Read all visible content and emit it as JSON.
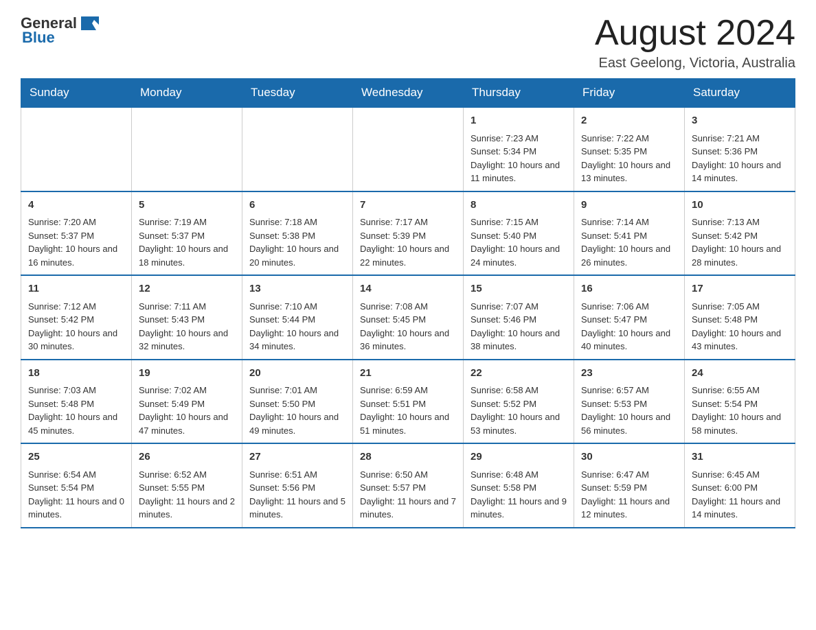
{
  "logo": {
    "general": "General",
    "blue": "Blue"
  },
  "title": "August 2024",
  "location": "East Geelong, Victoria, Australia",
  "days_of_week": [
    "Sunday",
    "Monday",
    "Tuesday",
    "Wednesday",
    "Thursday",
    "Friday",
    "Saturday"
  ],
  "weeks": [
    [
      {
        "day": "",
        "info": ""
      },
      {
        "day": "",
        "info": ""
      },
      {
        "day": "",
        "info": ""
      },
      {
        "day": "",
        "info": ""
      },
      {
        "day": "1",
        "info": "Sunrise: 7:23 AM\nSunset: 5:34 PM\nDaylight: 10 hours and 11 minutes."
      },
      {
        "day": "2",
        "info": "Sunrise: 7:22 AM\nSunset: 5:35 PM\nDaylight: 10 hours and 13 minutes."
      },
      {
        "day": "3",
        "info": "Sunrise: 7:21 AM\nSunset: 5:36 PM\nDaylight: 10 hours and 14 minutes."
      }
    ],
    [
      {
        "day": "4",
        "info": "Sunrise: 7:20 AM\nSunset: 5:37 PM\nDaylight: 10 hours and 16 minutes."
      },
      {
        "day": "5",
        "info": "Sunrise: 7:19 AM\nSunset: 5:37 PM\nDaylight: 10 hours and 18 minutes."
      },
      {
        "day": "6",
        "info": "Sunrise: 7:18 AM\nSunset: 5:38 PM\nDaylight: 10 hours and 20 minutes."
      },
      {
        "day": "7",
        "info": "Sunrise: 7:17 AM\nSunset: 5:39 PM\nDaylight: 10 hours and 22 minutes."
      },
      {
        "day": "8",
        "info": "Sunrise: 7:15 AM\nSunset: 5:40 PM\nDaylight: 10 hours and 24 minutes."
      },
      {
        "day": "9",
        "info": "Sunrise: 7:14 AM\nSunset: 5:41 PM\nDaylight: 10 hours and 26 minutes."
      },
      {
        "day": "10",
        "info": "Sunrise: 7:13 AM\nSunset: 5:42 PM\nDaylight: 10 hours and 28 minutes."
      }
    ],
    [
      {
        "day": "11",
        "info": "Sunrise: 7:12 AM\nSunset: 5:42 PM\nDaylight: 10 hours and 30 minutes."
      },
      {
        "day": "12",
        "info": "Sunrise: 7:11 AM\nSunset: 5:43 PM\nDaylight: 10 hours and 32 minutes."
      },
      {
        "day": "13",
        "info": "Sunrise: 7:10 AM\nSunset: 5:44 PM\nDaylight: 10 hours and 34 minutes."
      },
      {
        "day": "14",
        "info": "Sunrise: 7:08 AM\nSunset: 5:45 PM\nDaylight: 10 hours and 36 minutes."
      },
      {
        "day": "15",
        "info": "Sunrise: 7:07 AM\nSunset: 5:46 PM\nDaylight: 10 hours and 38 minutes."
      },
      {
        "day": "16",
        "info": "Sunrise: 7:06 AM\nSunset: 5:47 PM\nDaylight: 10 hours and 40 minutes."
      },
      {
        "day": "17",
        "info": "Sunrise: 7:05 AM\nSunset: 5:48 PM\nDaylight: 10 hours and 43 minutes."
      }
    ],
    [
      {
        "day": "18",
        "info": "Sunrise: 7:03 AM\nSunset: 5:48 PM\nDaylight: 10 hours and 45 minutes."
      },
      {
        "day": "19",
        "info": "Sunrise: 7:02 AM\nSunset: 5:49 PM\nDaylight: 10 hours and 47 minutes."
      },
      {
        "day": "20",
        "info": "Sunrise: 7:01 AM\nSunset: 5:50 PM\nDaylight: 10 hours and 49 minutes."
      },
      {
        "day": "21",
        "info": "Sunrise: 6:59 AM\nSunset: 5:51 PM\nDaylight: 10 hours and 51 minutes."
      },
      {
        "day": "22",
        "info": "Sunrise: 6:58 AM\nSunset: 5:52 PM\nDaylight: 10 hours and 53 minutes."
      },
      {
        "day": "23",
        "info": "Sunrise: 6:57 AM\nSunset: 5:53 PM\nDaylight: 10 hours and 56 minutes."
      },
      {
        "day": "24",
        "info": "Sunrise: 6:55 AM\nSunset: 5:54 PM\nDaylight: 10 hours and 58 minutes."
      }
    ],
    [
      {
        "day": "25",
        "info": "Sunrise: 6:54 AM\nSunset: 5:54 PM\nDaylight: 11 hours and 0 minutes."
      },
      {
        "day": "26",
        "info": "Sunrise: 6:52 AM\nSunset: 5:55 PM\nDaylight: 11 hours and 2 minutes."
      },
      {
        "day": "27",
        "info": "Sunrise: 6:51 AM\nSunset: 5:56 PM\nDaylight: 11 hours and 5 minutes."
      },
      {
        "day": "28",
        "info": "Sunrise: 6:50 AM\nSunset: 5:57 PM\nDaylight: 11 hours and 7 minutes."
      },
      {
        "day": "29",
        "info": "Sunrise: 6:48 AM\nSunset: 5:58 PM\nDaylight: 11 hours and 9 minutes."
      },
      {
        "day": "30",
        "info": "Sunrise: 6:47 AM\nSunset: 5:59 PM\nDaylight: 11 hours and 12 minutes."
      },
      {
        "day": "31",
        "info": "Sunrise: 6:45 AM\nSunset: 6:00 PM\nDaylight: 11 hours and 14 minutes."
      }
    ]
  ]
}
